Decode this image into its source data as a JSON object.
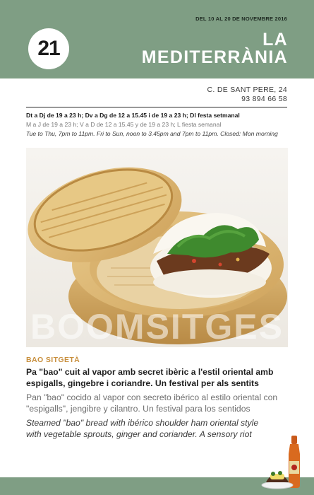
{
  "header": {
    "dates": "DEL 10 AL 20 DE NOVEMBRE 2016",
    "number": "21",
    "title_line1": "LA",
    "title_line2": "MEDITERRÀNIA"
  },
  "address": {
    "street": "C. DE SANT PERE, 24",
    "phone": "93 894 66 58"
  },
  "hours": {
    "ca": "Dt a Dj de 19 a 23 h; Dv a Dg de 12 a 15.45 i de 19 a 23 h; Dl festa setmanal",
    "es": "M a J de 19 a 23 h; V a D de 12 a 15.45 y de 19 a 23 h; L fiesta semanal",
    "en": "Tue to Thu, 7pm to 11pm. Fri to Sun, noon to 3.45pm and 7pm to 11pm. Closed: Mon morning"
  },
  "photo": {
    "watermark": "BOOMSITGES"
  },
  "dish": {
    "name": "BAO SITGETÀ",
    "desc_ca": "Pa \"bao\" cuit al vapor amb secret ibèric a l'estil oriental amb espigalls, gingebre i coriandre. Un festival per als sentits",
    "desc_es": "Pan \"bao\" cocido al vapor con secreto ibérico al estilo oriental con \"espigalls\", jengibre y cilantro. Un festival para los sentidos",
    "desc_en": "Steamed \"bao\" bread with ibérico shoulder ham oriental style with vegetable sprouts, ginger and coriander. A sensory riot"
  },
  "colors": {
    "header_green": "#7f9e84",
    "accent_gold": "#c88f3d"
  },
  "icons": [
    "beer-bottle-icon",
    "tapa-plate-icon"
  ]
}
